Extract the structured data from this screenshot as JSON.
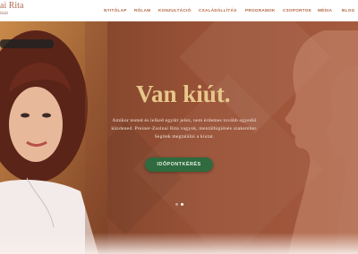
{
  "brand": {
    "name": "ai Rita",
    "subtitle": "ikiát"
  },
  "nav": {
    "items": [
      {
        "label": "NYITÓLAP"
      },
      {
        "label": "RÓLAM"
      },
      {
        "label": "KONZULTÁCIÓ"
      },
      {
        "label": "CSALÁDÁLLÍTÁS"
      },
      {
        "label": "PROGRAMOK"
      },
      {
        "label": "CSOPORTOK"
      },
      {
        "label": "MÉDIA"
      },
      {
        "label": "BLOG"
      }
    ]
  },
  "hero": {
    "headline": "Van kiút.",
    "body_line1": "Amikor tested és lelked együtt jelez, nem érdemes tovább egyedül",
    "body_line2": "küzdened. Preiner-Zsolnai Rita vagyok, mentálhigiénés szakember.",
    "body_line3": "Segítek megtalálni a kiutat.",
    "cta_label": "IDŐPONTKÉRÉS",
    "slide_count": 2,
    "active_slide": 1
  },
  "colors": {
    "accent": "#b3643f",
    "headline": "#e8c78a",
    "cta_bg": "#2f6b3e",
    "hero_bg": "#8a4a30"
  }
}
